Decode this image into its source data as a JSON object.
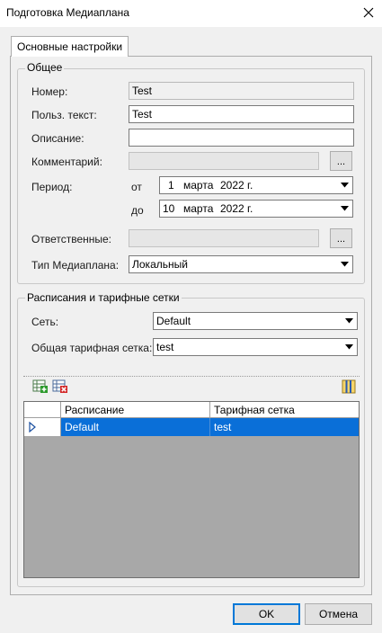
{
  "window": {
    "title": "Подготовка Медиаплана",
    "close_icon": "close-icon"
  },
  "tabs": [
    {
      "label": "Основные настройки",
      "active": true
    }
  ],
  "general": {
    "title": "Общее",
    "number": {
      "label": "Номер:",
      "value": "Test"
    },
    "user_text": {
      "label": "Польз. текст:",
      "value": "Test"
    },
    "description": {
      "label": "Описание:",
      "value": ""
    },
    "comment": {
      "label": "Комментарий:",
      "value": "",
      "button": "..."
    },
    "period": {
      "label": "Период:",
      "from": {
        "label": "от",
        "day": "1",
        "month": "марта",
        "year": "2022 г."
      },
      "to": {
        "label": "до",
        "day": "10",
        "month": "марта",
        "year": "2022 г."
      }
    },
    "responsible": {
      "label": "Ответственные:",
      "value": "",
      "button": "..."
    },
    "plan_type": {
      "label": "Тип Медиаплана:",
      "value": "Локальный"
    }
  },
  "schedules": {
    "title": "Расписания и тарифные сетки",
    "network": {
      "label": "Сеть:",
      "value": "Default"
    },
    "tariff": {
      "label": "Общая тарифная сетка:",
      "value": "test"
    },
    "toolbar": {
      "add_icon": "add-row-icon",
      "delete_icon": "delete-row-icon",
      "columns_icon": "column-chooser-icon"
    },
    "grid": {
      "columns": [
        "Расписание",
        "Тарифная сетка"
      ],
      "rows": [
        {
          "schedule": "Default",
          "tariff": "test",
          "selected": true
        }
      ]
    }
  },
  "buttons": {
    "ok": "OK",
    "cancel": "Отмена"
  },
  "colors": {
    "selection": "#0a6fd8",
    "grid_background": "#a8a8a8",
    "accent": "#0078d7"
  }
}
